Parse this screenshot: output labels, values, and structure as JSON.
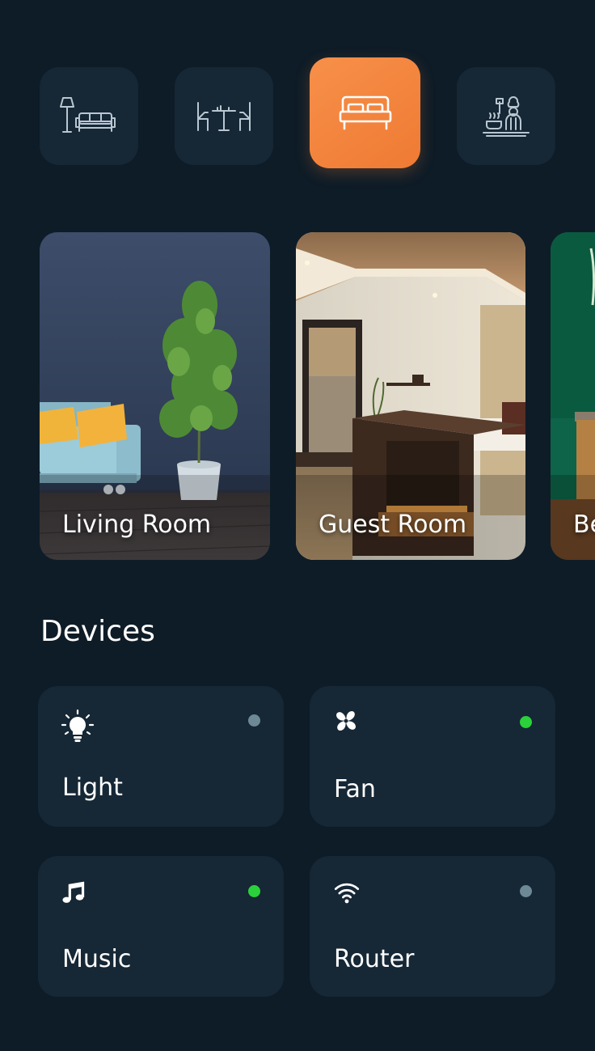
{
  "categories": [
    {
      "name": "living-room",
      "icon": "lamp-sofa-icon",
      "active": false
    },
    {
      "name": "dining-room",
      "icon": "dining-table-icon",
      "active": false
    },
    {
      "name": "bedroom",
      "icon": "bed-icon",
      "active": true
    },
    {
      "name": "kitchen",
      "icon": "chef-icon",
      "active": false
    }
  ],
  "rooms": [
    {
      "label": "Living Room"
    },
    {
      "label": "Guest Room"
    },
    {
      "label": "Be"
    }
  ],
  "devices": {
    "title": "Devices",
    "items": [
      {
        "label": "Light",
        "icon": "lightbulb-icon",
        "status": "off"
      },
      {
        "label": "Fan",
        "icon": "fan-icon",
        "status": "on"
      },
      {
        "label": "Music",
        "icon": "music-note-icon",
        "status": "on"
      },
      {
        "label": "Router",
        "icon": "wifi-icon",
        "status": "off"
      }
    ]
  },
  "colors": {
    "background": "#0e1c27",
    "card": "#162735",
    "accent": "#f08239",
    "status_on": "#2ad13a",
    "status_off": "#6d8996"
  }
}
